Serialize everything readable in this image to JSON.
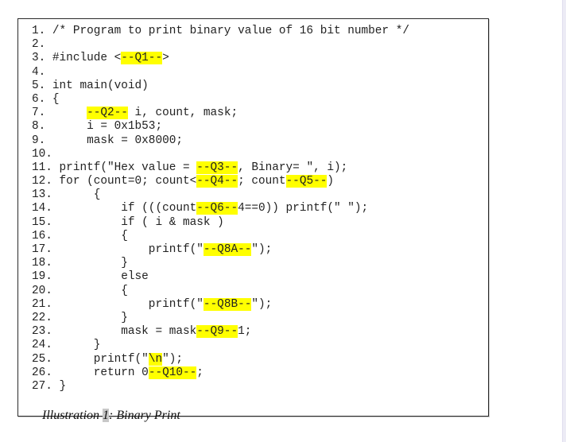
{
  "document": {
    "code_lines": [
      [
        {
          "t": "1. /* Program to print binary value of 16 bit number */"
        }
      ],
      [
        {
          "t": "2."
        }
      ],
      [
        {
          "t": "3. #include <"
        },
        {
          "t": "--Q1--",
          "hl": true
        },
        {
          "t": ">"
        }
      ],
      [
        {
          "t": "4."
        }
      ],
      [
        {
          "t": "5. int main(void)"
        }
      ],
      [
        {
          "t": "6. {"
        }
      ],
      [
        {
          "t": "7.      "
        },
        {
          "t": "--Q2--",
          "hl": true
        },
        {
          "t": " i, count, mask;"
        }
      ],
      [
        {
          "t": "8.      i = 0x1b53;"
        }
      ],
      [
        {
          "t": "9.      mask = 0x8000;"
        }
      ],
      [
        {
          "t": "10."
        }
      ],
      [
        {
          "t": "11. printf(\"Hex value = "
        },
        {
          "t": "--Q3--",
          "hl": true
        },
        {
          "t": ", Binary= \", i);"
        }
      ],
      [
        {
          "t": "12. for (count=0; count<"
        },
        {
          "t": "--Q4--",
          "hl": true
        },
        {
          "t": "; count"
        },
        {
          "t": "--Q5--",
          "hl": true
        },
        {
          "t": ")"
        }
      ],
      [
        {
          "t": "13.      {"
        }
      ],
      [
        {
          "t": "14.          if (((count"
        },
        {
          "t": "--Q6--",
          "hl": true
        },
        {
          "t": "4==0)) printf(\" \");"
        }
      ],
      [
        {
          "t": "15.          if ( i & mask )"
        }
      ],
      [
        {
          "t": "16.          {"
        }
      ],
      [
        {
          "t": "17.              printf(\""
        },
        {
          "t": "--Q8A--",
          "hl": true
        },
        {
          "t": "\");"
        }
      ],
      [
        {
          "t": "18.          }"
        }
      ],
      [
        {
          "t": "19.          else"
        }
      ],
      [
        {
          "t": "20.          {"
        }
      ],
      [
        {
          "t": "21.              printf(\""
        },
        {
          "t": "--Q8B--",
          "hl": true
        },
        {
          "t": "\");"
        }
      ],
      [
        {
          "t": "22.          }"
        }
      ],
      [
        {
          "t": "23.          mask = mask"
        },
        {
          "t": "--Q9--",
          "hl": true
        },
        {
          "t": "1;"
        }
      ],
      [
        {
          "t": "24.      }"
        }
      ],
      [
        {
          "t": "25.      printf(\""
        },
        {
          "t": "\\n",
          "hl": true
        },
        {
          "t": "\");"
        }
      ],
      [
        {
          "t": "26.      return 0"
        },
        {
          "t": "--Q10--",
          "hl": true
        },
        {
          "t": ";"
        }
      ],
      [
        {
          "t": "27. }"
        }
      ]
    ],
    "caption": {
      "prefix": "Illustration ",
      "number": "1",
      "suffix": ": Binary Print"
    },
    "colors": {
      "highlight": "#ffff00",
      "caption_number_bg": "#c8c8c8",
      "frame_border": "#2a2a2a"
    }
  }
}
